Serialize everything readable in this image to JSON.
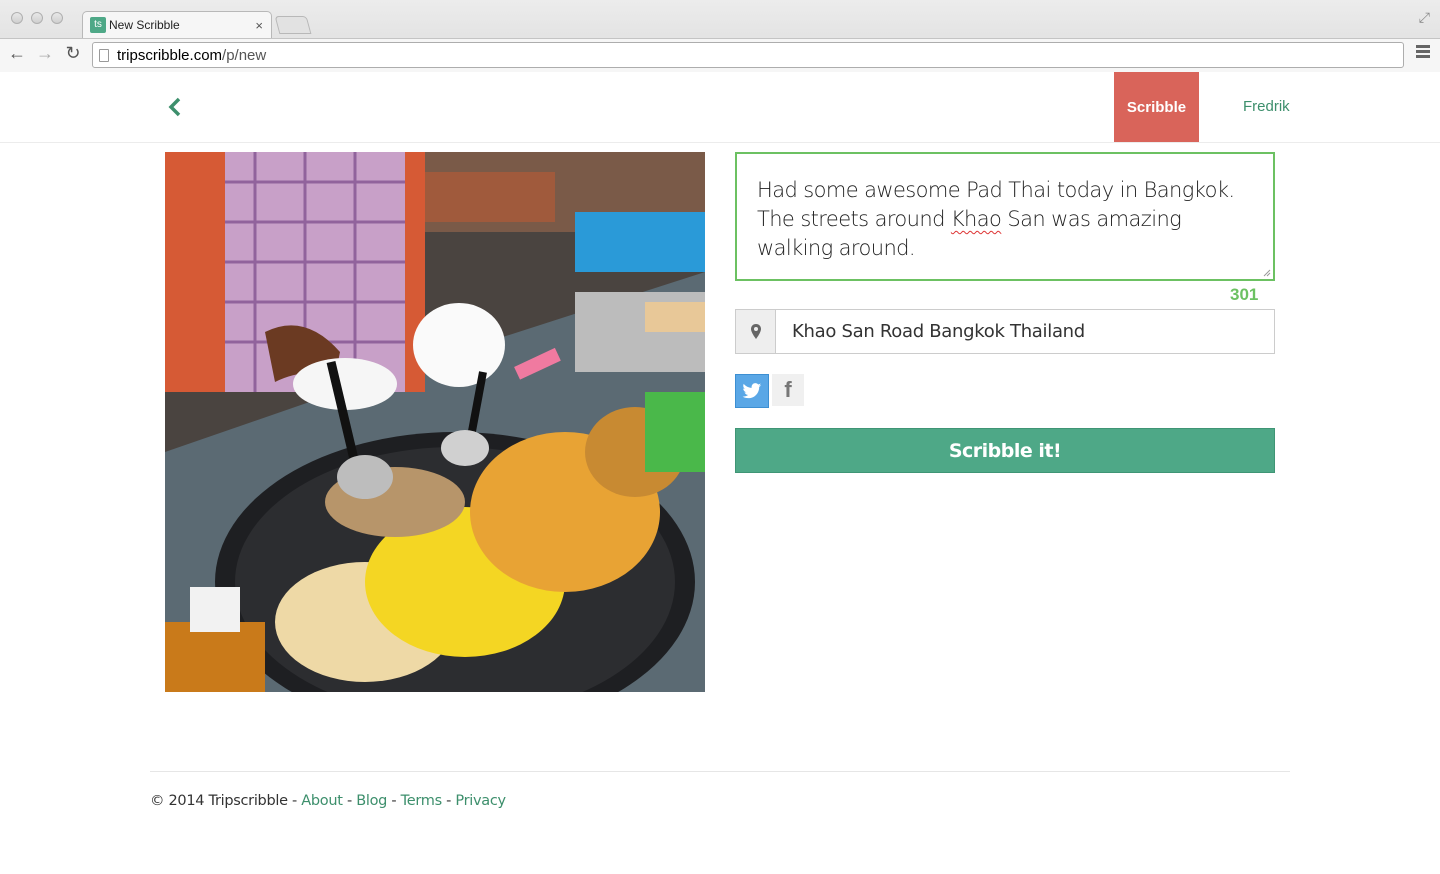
{
  "browser": {
    "tab_title": "New Scribble",
    "tab_close": "×",
    "url_host": "tripscribble.com",
    "url_path": "/p/new",
    "back": "←",
    "forward": "→",
    "reload": "↻"
  },
  "header": {
    "nav_scribble": "Scribble",
    "nav_user": "Fredrik"
  },
  "form": {
    "text_part1": "Had some awesome Pad Thai today in Bangkok. The streets around ",
    "text_misspelled": "Khao",
    "text_part2": " San was amazing walking around.",
    "char_counter": "301",
    "location_value": "Khao San Road Bangkok Thailand",
    "submit_label": "Scribble it!",
    "facebook_glyph": "f"
  },
  "footer": {
    "copyright": "© 2014 Tripscribble",
    "sep": " - ",
    "about": "About",
    "blog": "Blog",
    "terms": "Terms",
    "privacy": "Privacy"
  },
  "colors": {
    "brand_green": "#4ea887",
    "active_nav_red": "#d9645a",
    "valid_green": "#6cc162",
    "twitter_blue": "#5aa7e6"
  }
}
